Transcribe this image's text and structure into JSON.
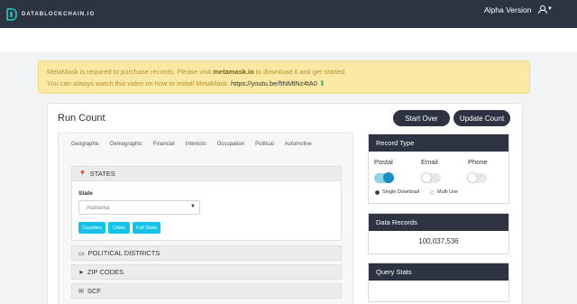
{
  "header": {
    "logo_text": "DATABLOCKCHAIN.IO",
    "version_label": "Alpha Version"
  },
  "alert": {
    "line1_prefix": "MetaMask is required to purchase records. Please visit ",
    "line1_link": "metamask.io",
    "line1_suffix": " to download it and get started.",
    "line2_prefix": "You can always watch this video on how to install MetaMask: ",
    "line2_link": "https://youtu.be/ftNMtNz4tA0"
  },
  "main": {
    "title": "Run Count",
    "start_over_label": "Start Over",
    "update_count_label": "Update Count",
    "tabs": [
      "Geographic",
      "Demographic",
      "Financial",
      "Interests",
      "Occupation",
      "Political",
      "Automotive"
    ],
    "sections": {
      "states": "STATES",
      "political": "POLITICAL DISTRICTS",
      "zip": "ZIP CODES",
      "scf": "SCF"
    },
    "state_label": "State",
    "state_value": "Alabama",
    "pills": [
      "Counties",
      "Cities",
      "Full State"
    ]
  },
  "record_type": {
    "title": "Record Type",
    "postal": "Postal",
    "email": "Email",
    "phone": "Phone",
    "single_download": "Single Download",
    "multi_use": "Multi Use"
  },
  "data_records": {
    "title": "Data Records",
    "value": "100,037,536"
  },
  "query_stats": {
    "title": "Query Stats"
  }
}
